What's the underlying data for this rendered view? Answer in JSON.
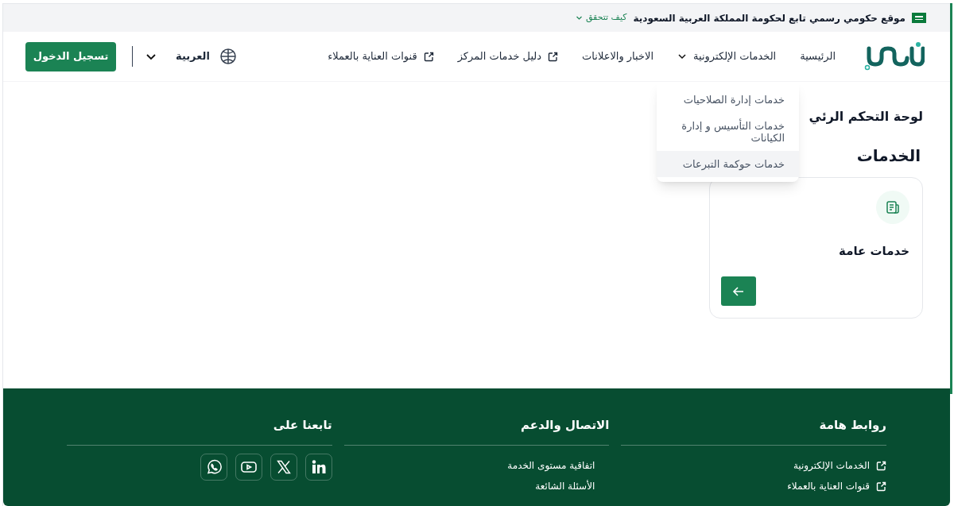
{
  "top_bar": {
    "text": "موقع حكومي رسمي تابع لحكومة المملكة العربية السعودية",
    "verify_link": "كيف تتحقق"
  },
  "nav": [
    {
      "label": "الرئيسية",
      "kind": "link"
    },
    {
      "label": "الخدمات الإلكترونية",
      "kind": "dropdown",
      "expanded": true
    },
    {
      "label": "الاخبار والاعلانات",
      "kind": "link"
    },
    {
      "label": "دليل خدمات المركز",
      "kind": "external"
    },
    {
      "label": "قنوات العناية بالعملاء",
      "kind": "external"
    }
  ],
  "dropdown_items": [
    {
      "label": "خدمات إدارة الصلاحيات",
      "selected": false
    },
    {
      "label": "خدمات التأسيس و إدارة الكيانات",
      "selected": false
    },
    {
      "label": "خدمات حوكمة التبرعات",
      "selected": true
    }
  ],
  "language": "العربية",
  "login_button": "تسجيل الدخول",
  "page_title": "لوحة التحكم الرئي",
  "section_title": "الخدمات",
  "cards": [
    {
      "title": "خدمات عامة"
    }
  ],
  "footer": [
    {
      "title": "روابط هامة",
      "kind": "links",
      "links": [
        {
          "label": "الخدمات الإلكترونية",
          "external": true
        },
        {
          "label": "قنوات العناية بالعملاء",
          "external": true
        }
      ]
    },
    {
      "title": "الاتصال والدعم",
      "kind": "links",
      "links": [
        {
          "label": "اتفاقية مستوى الخدمة",
          "external": false
        },
        {
          "label": "الأسئلة الشائعة",
          "external": false
        }
      ]
    },
    {
      "title": "تابعنا على",
      "kind": "social",
      "icons": [
        {
          "kind": "linkedin"
        },
        {
          "kind": "x"
        },
        {
          "kind": "youtube"
        },
        {
          "kind": "whatsapp"
        }
      ]
    }
  ]
}
